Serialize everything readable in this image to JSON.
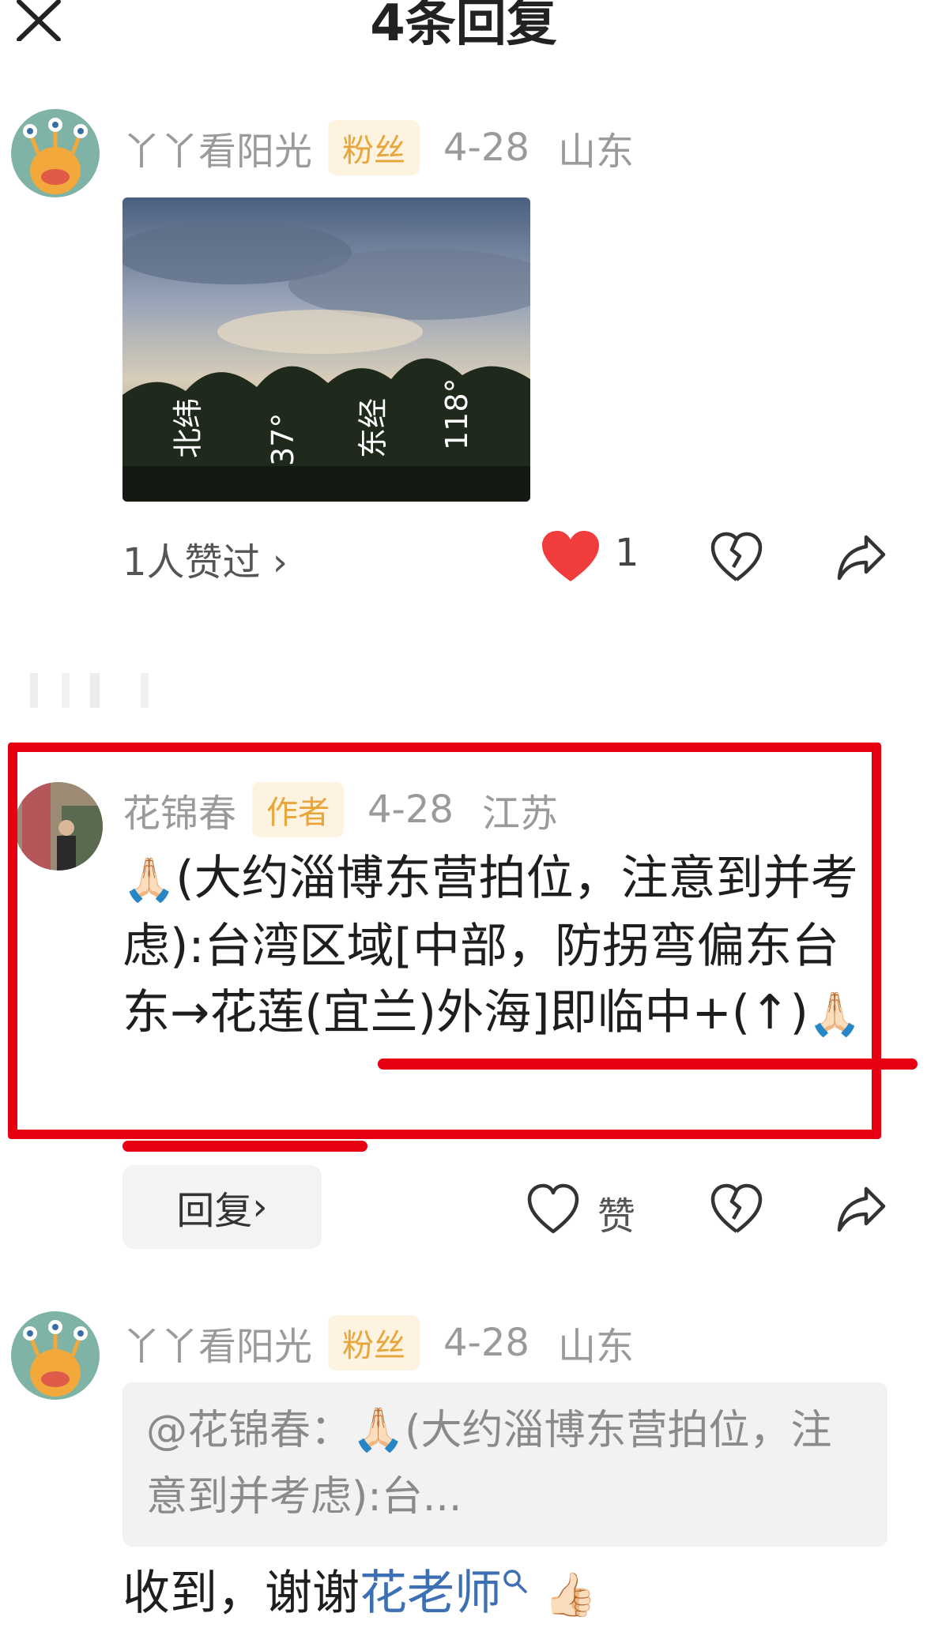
{
  "header": {
    "title": "4条回复"
  },
  "comments": [
    {
      "user": "丫丫看阳光",
      "badge": "粉丝",
      "date": "4-28",
      "location": "山东",
      "photo_caption": [
        "北纬",
        "37°",
        "东经",
        "118°"
      ],
      "likes_link": "1人赞过",
      "like_count": "1"
    },
    {
      "user": "花锦春",
      "badge": "作者",
      "date": "4-28",
      "location": "江苏",
      "emoji_start": "🙏🏻",
      "text": "(大约淄博东营拍位，注意到并考虑):台湾区域[中部，防拐弯偏东台东→花莲(宜兰)外海]即临中+(↑)",
      "emoji_end": "🙏🏻",
      "reply_label": "回复",
      "like_label": "赞"
    },
    {
      "user": "丫丫看阳光",
      "badge": "粉丝",
      "date": "4-28",
      "location": "山东",
      "quote_prefix": "@花锦春：",
      "quote_emoji": "🙏🏻",
      "quote_text": "(大约淄博东营拍位，注意到并考虑):台...",
      "reply_text": "收到，谢谢",
      "mention": "花老师",
      "reply_emoji": "👍🏻"
    }
  ],
  "colors": {
    "highlight": "#e60012",
    "badge_bg": "#fdf3e0",
    "badge_text": "#e8a53a",
    "heart": "#f03c3c",
    "mention": "#3d6fb4"
  }
}
